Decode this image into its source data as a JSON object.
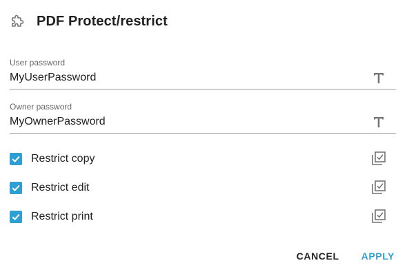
{
  "dialog": {
    "title": "PDF Protect/restrict",
    "icon": "puzzle-icon"
  },
  "fields": {
    "user_password": {
      "label": "User password",
      "value": "MyUserPassword",
      "type_icon": "text-type-icon"
    },
    "owner_password": {
      "label": "Owner password",
      "value": "MyOwnerPassword",
      "type_icon": "text-type-icon"
    }
  },
  "checkboxes": [
    {
      "label": "Restrict copy",
      "checked": true,
      "type_icon": "checkbox-type-icon"
    },
    {
      "label": "Restrict edit",
      "checked": true,
      "type_icon": "checkbox-type-icon"
    },
    {
      "label": "Restrict print",
      "checked": true,
      "type_icon": "checkbox-type-icon"
    }
  ],
  "actions": {
    "cancel_label": "CANCEL",
    "apply_label": "APPLY"
  },
  "colors": {
    "accent": "#2e9fd2",
    "text": "#212121",
    "secondary_text": "#666666",
    "icon": "#757575"
  }
}
